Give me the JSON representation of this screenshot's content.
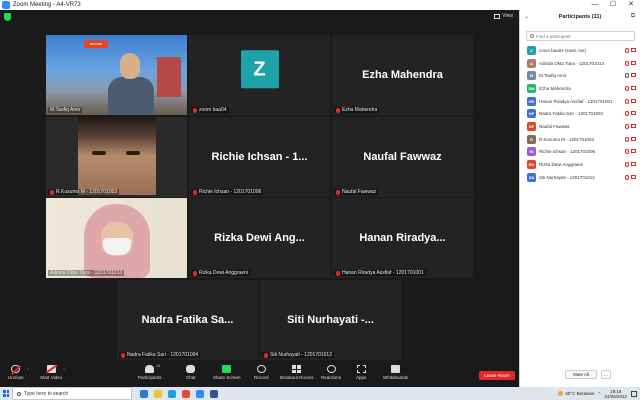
{
  "window": {
    "title": "Zoom Meeting - A4-VR73",
    "controls": [
      "—",
      "☐",
      "✕"
    ]
  },
  "view_label": "View",
  "tiles": [
    {
      "name": "M.Taufiq Amir",
      "kind": "video"
    },
    {
      "name": "zoom baa04",
      "kind": "avatar",
      "initial": "Z"
    },
    {
      "name": "Ezha Mahendra",
      "big": "Ezha Mahendra"
    },
    {
      "name": "R.Kusumo M - 1201701003",
      "kind": "video"
    },
    {
      "name": "Richie Ichsan - 1201701006",
      "big": "Richie Ichsan - 1..."
    },
    {
      "name": "Naufal Fawwaz",
      "big": "Naufal Fawwaz"
    },
    {
      "name": "Adinda Okta Tiara - 1201701013",
      "kind": "video",
      "active": true
    },
    {
      "name": "Rizka Dewi Anggraeni",
      "big": "Rizka Dewi Ang..."
    },
    {
      "name": "Hanan Riradya Assfiaf - 1201701001",
      "big": "Hanan Riradya..."
    },
    {
      "name": "Nadra Fatika Sari - 1201701004",
      "big": "Nadra Fatika Sa..."
    },
    {
      "name": "Siti Nurhayati - 1201701012",
      "big": "Siti Nurhayati -..."
    }
  ],
  "video_logo_text": "BAKARE",
  "toolbar": {
    "unmute": "Unmute",
    "start_video": "Start Video",
    "participants": "Participants",
    "participants_count": "11",
    "chat": "Chat",
    "share_screen": "Share Screen",
    "record": "Record",
    "breakout_rooms": "Breakout Rooms",
    "reactions": "Reactions",
    "apps": "Apps",
    "whiteboards": "Whiteboards",
    "leave": "Leave Room"
  },
  "panel": {
    "title": "Participants (11)",
    "search_placeholder": "Find a participant",
    "mute_all": "Mute All",
    "more": "...",
    "participants": [
      {
        "initials": "Z",
        "name": "zoom baa04 (Host, me)",
        "color": "#1fa2a7",
        "mic_on": false
      },
      {
        "initials": "A",
        "name": "Adinda Okta Tiara - 1201701013",
        "color": "#b47a6a",
        "mic_on": false
      },
      {
        "initials": "M",
        "name": "M.Taufiq Amir",
        "color": "#7a8aa0",
        "mic_on": true
      },
      {
        "initials": "EM",
        "name": "Ezha Mahendra",
        "color": "#2bb56b",
        "mic_on": false
      },
      {
        "initials": "HR",
        "name": "Hanan Riradya Assfiaf - 1201701001",
        "color": "#3f6fd8",
        "mic_on": false
      },
      {
        "initials": "NF",
        "name": "Nadra Fatika Sari - 1201701004",
        "color": "#3f6fd8",
        "mic_on": false
      },
      {
        "initials": "NF",
        "name": "Naufal Fawwaz",
        "color": "#d9482b",
        "mic_on": false
      },
      {
        "initials": "R",
        "name": "R.Kusumo M - 1201701003",
        "color": "#8a6a55",
        "mic_on": false
      },
      {
        "initials": "RI",
        "name": "Richie Ichsan - 1201701006",
        "color": "#9b5ad6",
        "mic_on": false
      },
      {
        "initials": "RD",
        "name": "Rizka Dewi Anggraeni",
        "color": "#d9482b",
        "mic_on": false
      },
      {
        "initials": "SN",
        "name": "Siti Nurhayati - 1201701012",
        "color": "#3f6fd8",
        "mic_on": false
      }
    ]
  },
  "taskbar": {
    "search_placeholder": "Type here to search",
    "weather": "30°C  Berawan",
    "time": "19:15",
    "date": "24/05/2022"
  }
}
